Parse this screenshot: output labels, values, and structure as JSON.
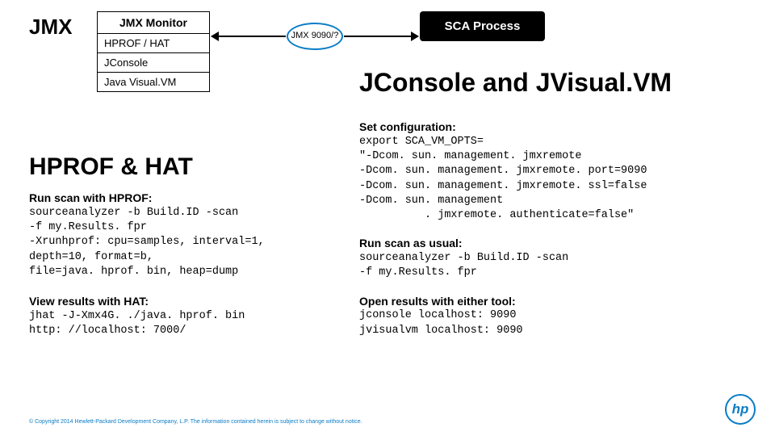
{
  "page_title": "JMX",
  "jmx_monitor": {
    "header": "JMX Monitor",
    "items": [
      "HPROF / HAT",
      "JConsole",
      "Java Visual.VM"
    ]
  },
  "connector": {
    "port_label": "JMX 9090/?"
  },
  "sca_box": "SCA Process",
  "right": {
    "heading": "JConsole and JVisual.VM",
    "set_config_label": "Set configuration:",
    "set_config_code": "export SCA_VM_OPTS=\n\"-Dcom. sun. management. jmxremote\n-Dcom. sun. management. jmxremote. port=9090\n-Dcom. sun. management. jmxremote. ssl=false\n-Dcom. sun. management\n          . jmxremote. authenticate=false\"",
    "run_label": "Run scan as usual:",
    "run_code": "sourceanalyzer -b Build.ID -scan\n-f my.Results. fpr",
    "open_label": "Open results with either tool:",
    "open_code": "jconsole localhost: 9090\njvisualvm localhost: 9090"
  },
  "left": {
    "heading": "HPROF & HAT",
    "run_label": "Run scan with HPROF:",
    "run_code": "sourceanalyzer -b Build.ID -scan\n-f my.Results. fpr\n-Xrunhprof: cpu=samples, interval=1,\ndepth=10, format=b,\nfile=java. hprof. bin, heap=dump",
    "view_label": "View results with HAT:",
    "view_code": "jhat -J-Xmx4G. ./java. hprof. bin\nhttp: //localhost: 7000/"
  },
  "footer": "© Copyright 2014 Hewlett-Packard Development Company, L.P.  The information contained herein is subject to change without notice.",
  "logo_text": "hp"
}
